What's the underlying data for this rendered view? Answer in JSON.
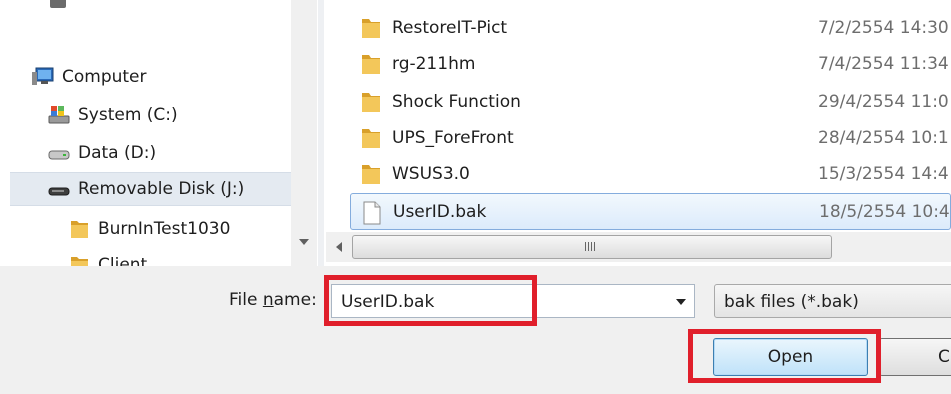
{
  "nav": {
    "items": [
      {
        "label": "Computer",
        "icon": "computer-icon"
      },
      {
        "label": "System (C:)",
        "icon": "system-drive-icon"
      },
      {
        "label": "Data (D:)",
        "icon": "drive-icon"
      },
      {
        "label": "Removable Disk (J:)",
        "icon": "removable-disk-icon",
        "selected": true
      },
      {
        "label": "BurnInTest1030",
        "icon": "folder-icon"
      },
      {
        "label": "Client",
        "icon": "folder-icon"
      }
    ]
  },
  "files": {
    "rows": [
      {
        "name": "RestoreIT-Pict",
        "date": "7/2/2554 14:30",
        "type": "folder"
      },
      {
        "name": "rg-211hm",
        "date": "7/4/2554 11:34",
        "type": "folder"
      },
      {
        "name": "Shock Function",
        "date": "29/4/2554 11:0",
        "type": "folder"
      },
      {
        "name": "UPS_ForeFront",
        "date": "28/4/2554 10:1",
        "type": "folder"
      },
      {
        "name": "WSUS3.0",
        "date": "15/3/2554 14:4",
        "type": "folder"
      },
      {
        "name": "UserID.bak",
        "date": "18/5/2554 10:4",
        "type": "file",
        "selected": true
      }
    ]
  },
  "bottom": {
    "filename_label_prefix": "File ",
    "filename_label_accel": "n",
    "filename_label_suffix": "ame:",
    "filename_value": "UserID.bak",
    "filetype_value": "bak files (*.bak)",
    "open_label": "Open",
    "cancel_label_partial": "C"
  },
  "colors": {
    "highlight": "#e01f2b",
    "selection": "#dcebfb",
    "folder": "#e8b53c"
  }
}
